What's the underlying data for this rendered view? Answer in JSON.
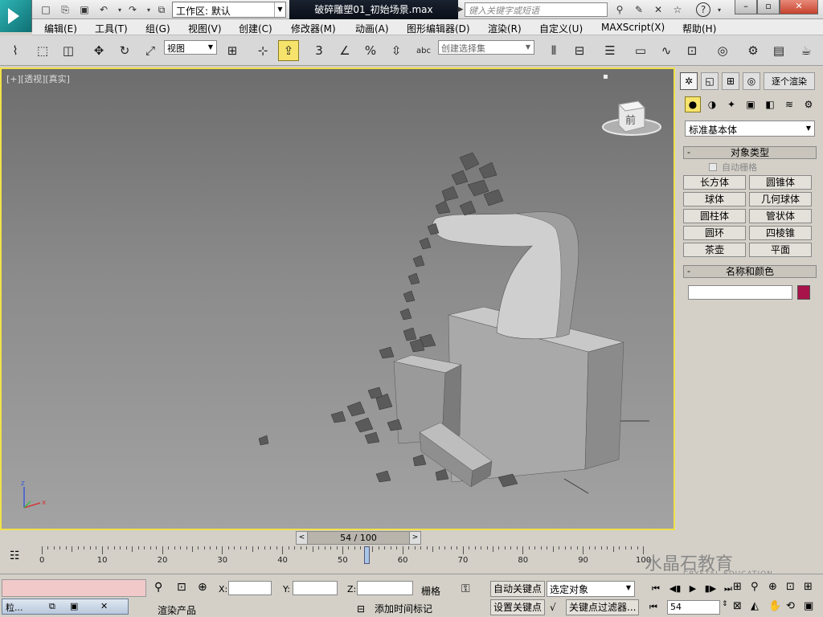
{
  "titlebar": {
    "workspace_label": "工作区: 默认",
    "document_title": "破碎雕塑01_初始场景.max",
    "search_placeholder": "键入关键字或短语",
    "help_label": "?"
  },
  "menu": [
    {
      "label": "编辑(E)"
    },
    {
      "label": "工具(T)"
    },
    {
      "label": "组(G)"
    },
    {
      "label": "视图(V)"
    },
    {
      "label": "创建(C)"
    },
    {
      "label": "修改器(M)"
    },
    {
      "label": "动画(A)"
    },
    {
      "label": "图形编辑器(D)"
    },
    {
      "label": "渲染(R)"
    },
    {
      "label": "自定义(U)"
    },
    {
      "label": "MAXScript(X)"
    },
    {
      "label": "帮助(H)"
    }
  ],
  "toolbar": {
    "reference_coord": "视图",
    "selection_set_placeholder": "创建选择集",
    "snap_label": "3",
    "percent_label": "%"
  },
  "viewport": {
    "label": "[+][透视][真实]",
    "viewcube_label": "前",
    "axis_x": "x",
    "axis_z": "z"
  },
  "command_panel": {
    "corner_label": "逐个渲染",
    "category_dropdown": "标准基本体",
    "object_type_title": "对象类型",
    "autogrid_label": "自动栅格",
    "objects": [
      "长方体",
      "圆锥体",
      "球体",
      "几何球体",
      "圆柱体",
      "管状体",
      "圆环",
      "四棱锥",
      "茶壶",
      "平面"
    ],
    "name_color_title": "名称和颜色",
    "name_value": "",
    "color": "#a8134a"
  },
  "timeline": {
    "frame_display": "54 / 100",
    "current_frame": 54,
    "total_frames": 100,
    "tick_labels": [
      "0",
      "10",
      "20",
      "30",
      "40",
      "50",
      "60",
      "70",
      "80",
      "90",
      "100"
    ]
  },
  "statusbar": {
    "taskbar_label": "粒...",
    "prompt": "渲染产品",
    "x_label": "X:",
    "y_label": "Y:",
    "z_label": "Z:",
    "grid_label": "栅格",
    "autokey_label": "自动关键点",
    "setkey_label": "设置关键点",
    "selected_object": "选定对象",
    "key_filter_label": "关键点过滤器...",
    "add_time_tag": "添加时间标记",
    "frame_field": "54"
  },
  "watermark": {
    "brand": "水晶石教育",
    "sub": "CRYSTAL EDUCATION"
  }
}
